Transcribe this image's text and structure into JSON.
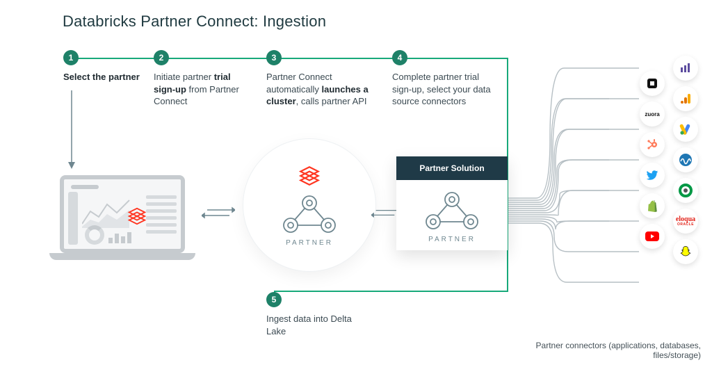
{
  "title": "Databricks Partner Connect: Ingestion",
  "steps": {
    "s1": {
      "num": "1",
      "plain_pre": "",
      "bold": "Select the partner",
      "plain_post": ""
    },
    "s2": {
      "num": "2",
      "plain_pre": "Initiate partner ",
      "bold": "trial sign-up",
      "plain_post": " from Partner Connect"
    },
    "s3": {
      "num": "3",
      "plain_pre": "Partner Connect automatically ",
      "bold": "launches a cluster",
      "plain_post": ", calls partner API"
    },
    "s4": {
      "num": "4",
      "plain_pre": "Complete partner trial sign-up, select your data source connectors",
      "bold": "",
      "plain_post": ""
    },
    "s5": {
      "num": "5",
      "plain_pre": "Ingest data into Delta Lake",
      "bold": "",
      "plain_post": ""
    }
  },
  "labels": {
    "partner": "PARTNER",
    "solution_header": "Partner Solution",
    "connectors_footer": "Partner connectors (applications, databases, files/storage)"
  },
  "connectors_left": [
    "square",
    "zuora",
    "hubspot",
    "twitter",
    "shopify",
    "youtube"
  ],
  "connectors_right": [
    "marketo",
    "google-analytics",
    "google-ads",
    "amplitude",
    "qlik",
    "eloqua",
    "snapchat"
  ],
  "colors": {
    "accent_green": "#17a97a",
    "badge_green": "#1e8168",
    "databricks_red": "#ff3621",
    "card_header": "#1f3a47",
    "ink": "#1f2a30",
    "muted": "#6f8790",
    "line_grey": "#b6bfc4"
  }
}
